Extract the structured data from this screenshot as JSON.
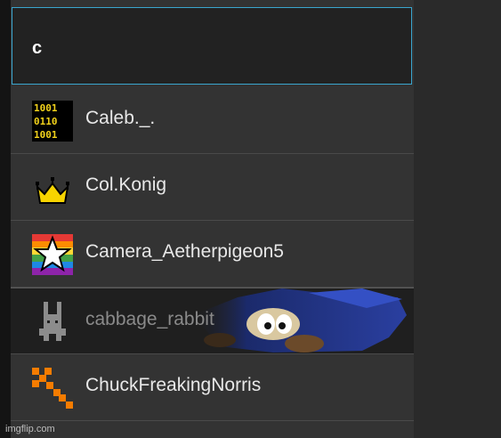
{
  "search": {
    "value": "c"
  },
  "results": [
    {
      "name": "Caleb._.",
      "icon": "binary-code-icon"
    },
    {
      "name": "Col.Konig",
      "icon": "crown-icon"
    },
    {
      "name": "Camera_Aetherpigeon5",
      "icon": "rainbow-star-icon"
    },
    {
      "name": "cabbage_rabbit",
      "icon": "pixel-rabbit-icon"
    },
    {
      "name": "ChuckFreakingNorris",
      "icon": "pixel-blocks-icon"
    }
  ],
  "watermark": "imgflip.com",
  "colors": {
    "accent": "#3aa6cf",
    "panel": "#333333",
    "search_bg": "#222222"
  }
}
